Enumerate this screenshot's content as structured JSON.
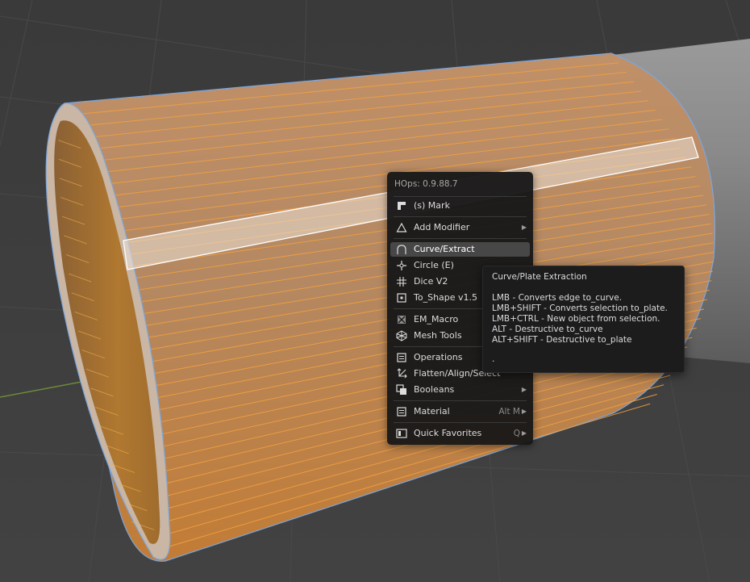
{
  "menu": {
    "header": "HOps: 0.9.88.7",
    "items": [
      {
        "label": "(s) Mark",
        "icon": "mark-icon"
      },
      {
        "label": "Add Modifier",
        "icon": "modifier-triangle-icon",
        "submenu": true
      },
      {
        "label": "Curve/Extract",
        "icon": "curve-icon",
        "active": true
      },
      {
        "label": "Circle (E)",
        "icon": "circle-icon"
      },
      {
        "label": "Dice V2",
        "icon": "dice-grid-icon"
      },
      {
        "label": "To_Shape v1.5",
        "icon": "to-shape-icon"
      },
      {
        "label": "EM_Macro",
        "icon": "macro-icon"
      },
      {
        "label": "Mesh Tools",
        "icon": "mesh-tools-icon"
      },
      {
        "label": "Operations",
        "icon": "operations-icon"
      },
      {
        "label": "Flatten/Align/Select",
        "icon": "flatten-icon"
      },
      {
        "label": "Booleans",
        "icon": "booleans-icon",
        "submenu": true
      },
      {
        "label": "Material",
        "icon": "material-icon",
        "shortcut": "Alt M",
        "submenu": true
      },
      {
        "label": "Quick Favorites",
        "icon": "favorites-icon",
        "shortcut": "Q",
        "submenu": true
      }
    ],
    "arrow_glyph": "▶"
  },
  "tooltip": {
    "title": "Curve/Plate Extraction",
    "lines": [
      "LMB - Converts edge to_curve.",
      "LMB+SHIFT - Converts selection to_plate.",
      "LMB+CTRL - New object from selection.",
      "ALT - Destructive to_curve",
      "ALT+SHIFT - Destructive to_plate"
    ],
    "footer": "."
  },
  "colors": {
    "background": "#3d3d3d",
    "selection_orange": "#f0a040",
    "active_edge": "#ffffff",
    "outline_blue": "#7aa6de",
    "menu_bg": "#181818"
  }
}
